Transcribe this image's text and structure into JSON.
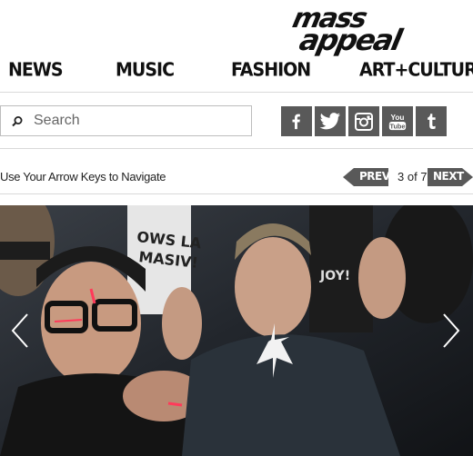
{
  "brand": {
    "line1": "mass",
    "line2": "appeal"
  },
  "nav": {
    "items": [
      "NEWS",
      "MUSIC",
      "FASHION",
      "ART+CULTURE"
    ]
  },
  "search": {
    "placeholder": "Search",
    "value": ""
  },
  "social": {
    "icons": [
      "facebook-icon",
      "twitter-icon",
      "instagram-icon",
      "youtube-icon",
      "tumblr-icon"
    ],
    "youtube_label": "You Tube"
  },
  "slideshow": {
    "instructions": "Use Your Arrow Keys to Navigate",
    "prev_label": "PREV",
    "next_label": "NEXT",
    "counter": "3 of 7"
  },
  "colors": {
    "social_bg": "#595959",
    "pager_arrow": "#595959",
    "text": "#111111"
  }
}
